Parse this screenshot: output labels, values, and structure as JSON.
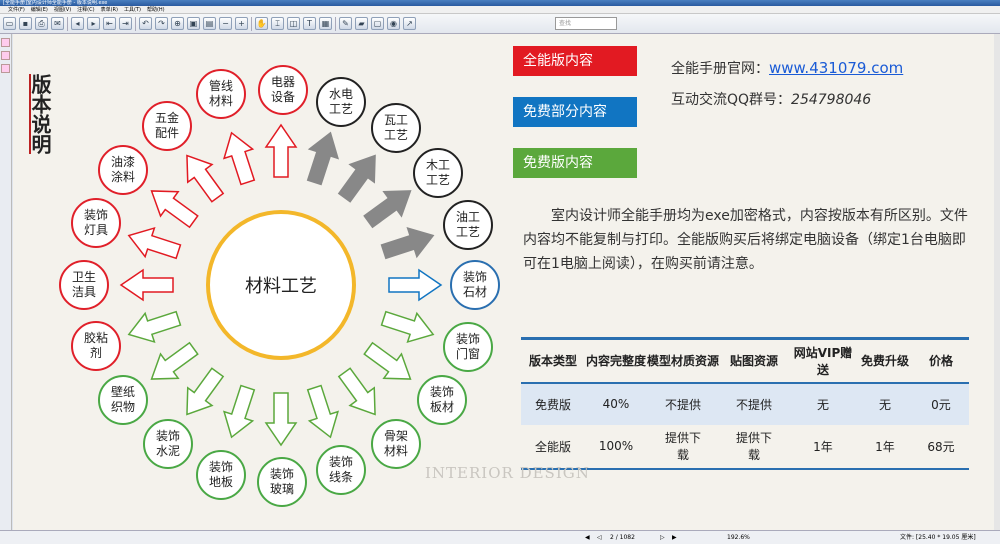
{
  "app": {
    "title": "[全能手册]室内设计师全能手册 - 版本说明.exe"
  },
  "menu": [
    "文件(F)",
    "编辑(E)",
    "视图(V)",
    "注释(C)",
    "表单(R)",
    "工具(T)",
    "帮助(H)"
  ],
  "toolbar": {
    "search_placeholder": "查找"
  },
  "page": {
    "side_title": "版本说明",
    "center_label": "材料工艺",
    "legend": {
      "full": "全能版内容",
      "free_part": "免费部分内容",
      "free": "免费版内容"
    },
    "legend_colors": {
      "full": "#e21a22",
      "free_part": "#1175c2",
      "free": "#5ba83c"
    },
    "site_label": "全能手册官网：",
    "site_url": "www.431079.com",
    "qq_label": "互动交流QQ群号：",
    "qq_number": "254798046",
    "description": "室内设计师全能手册均为exe加密格式，内容按版本有所区别。文件内容均不能复制与打印。全能版购买后将绑定电脑设备（绑定1台电脑即可在1电脑上阅读），在购买前请注意。",
    "circles": {
      "pipes": "管线材料",
      "appliances": "电器设备",
      "plumbing": "水电工艺",
      "tile": "瓦工工艺",
      "carpentry": "木工工艺",
      "painting": "油工工艺",
      "stone": "装饰石材",
      "doors": "装饰门窗",
      "boards": "装饰板材",
      "frames": "骨架材料",
      "lines": "装饰线条",
      "glass": "装饰玻璃",
      "floor": "装饰地板",
      "cement": "装饰水泥",
      "wallpaper": "壁纸织物",
      "adhesive": "胶粘剂",
      "sanitary": "卫生洁具",
      "lamps": "装饰灯具",
      "coatings": "油漆涂料",
      "hardware": "五金配件"
    },
    "table": {
      "headers": [
        "版本类型",
        "内容完整度",
        "模型材质资源",
        "贴图资源",
        "网站VIP赠送",
        "免费升级",
        "价格"
      ],
      "rows": [
        [
          "免费版",
          "40%",
          "不提供",
          "不提供",
          "无",
          "无",
          "0元"
        ],
        [
          "全能版",
          "100%",
          "提供下载",
          "提供下载",
          "1年",
          "1年",
          "68元"
        ]
      ]
    },
    "watermark": "INTERIOR DESIGN"
  },
  "status": {
    "page": "2 / 1082",
    "zoom": "192.6%",
    "size": "文件: [25.40 * 19.05 厘米]"
  }
}
